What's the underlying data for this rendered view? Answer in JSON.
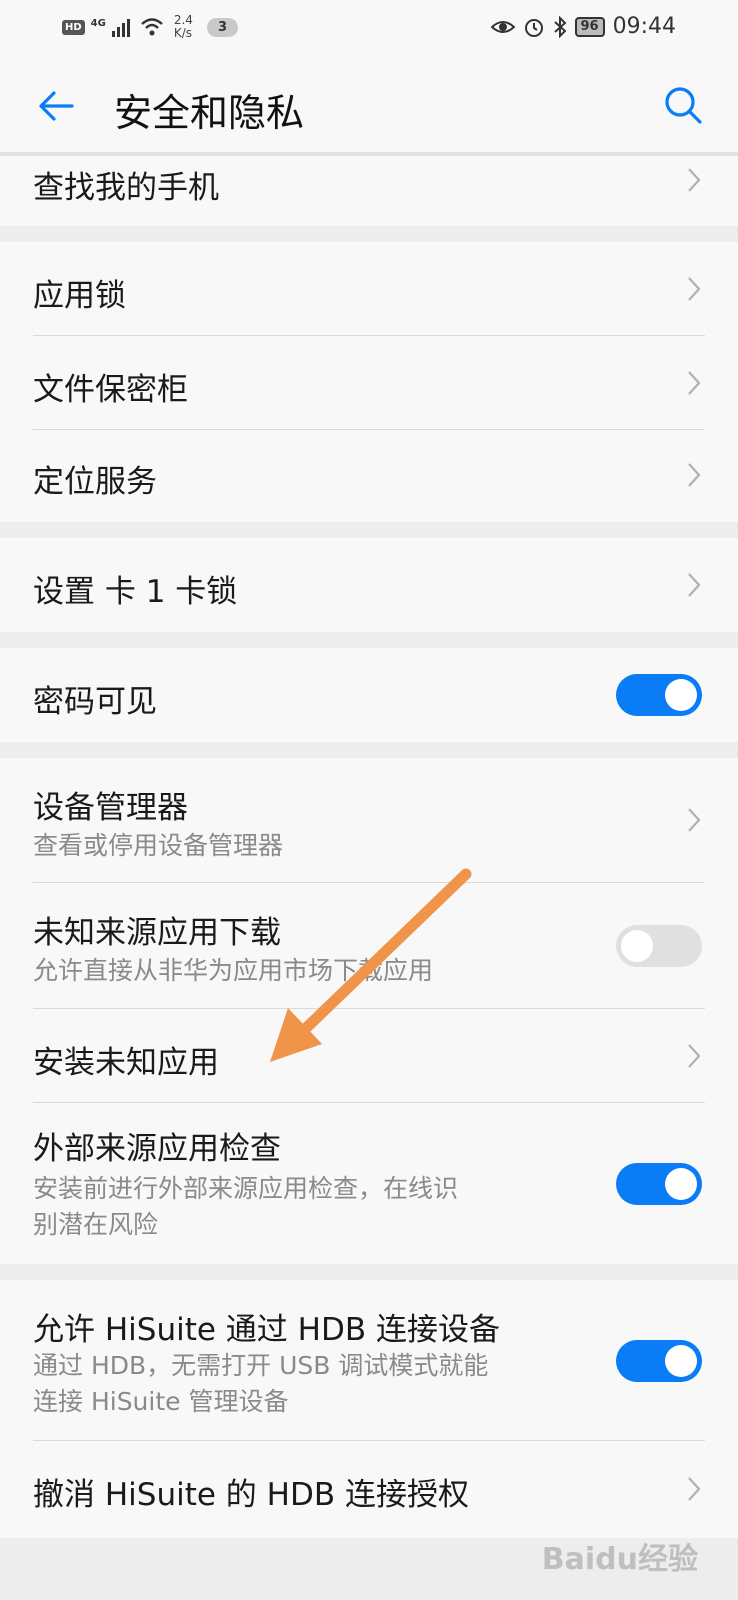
{
  "status_bar": {
    "hd": "HD",
    "network": "4G",
    "speed_value": "2.4",
    "speed_unit": "K/s",
    "notification_count": "3",
    "battery": "96",
    "time": "09:44"
  },
  "header": {
    "title": "安全和隐私"
  },
  "items": {
    "find_phone": {
      "label": "查找我的手机"
    },
    "app_lock": {
      "label": "应用锁"
    },
    "file_safe": {
      "label": "文件保密柜"
    },
    "location": {
      "label": "定位服务"
    },
    "sim_lock": {
      "label": "设置 卡 1 卡锁"
    },
    "password_visible": {
      "label": "密码可见",
      "toggle": "on"
    },
    "device_admin": {
      "label": "设备管理器",
      "subtitle": "查看或停用设备管理器"
    },
    "unknown_source_download": {
      "label": "未知来源应用下载",
      "subtitle": "允许直接从非华为应用市场下载应用",
      "toggle": "off"
    },
    "install_unknown": {
      "label": "安装未知应用"
    },
    "external_check": {
      "label": "外部来源应用检查",
      "subtitle_line1": "安装前进行外部来源应用检查，在线识",
      "subtitle_line2": "别潜在风险",
      "toggle": "on"
    },
    "hisuite_hdb": {
      "label": "允许 HiSuite 通过 HDB 连接设备",
      "subtitle_line1": "通过 HDB，无需打开 USB 调试模式就能",
      "subtitle_line2": "连接 HiSuite 管理设备",
      "toggle": "on"
    },
    "revoke_hdb": {
      "label": "撤消 HiSuite 的 HDB 连接授权"
    }
  },
  "colors": {
    "accent": "#0a7cf6",
    "annotation_arrow": "#f0944a"
  },
  "watermark": "Baidu经验"
}
